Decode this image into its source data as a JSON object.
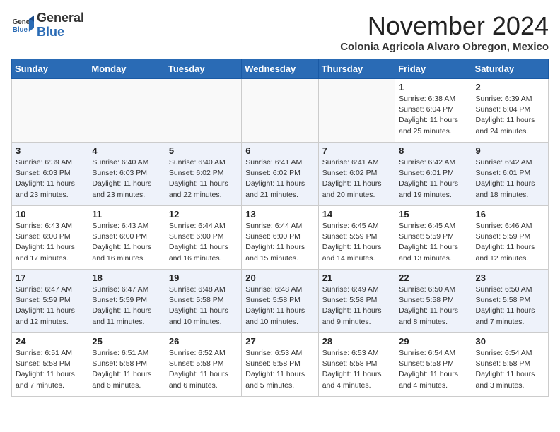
{
  "header": {
    "logo_general": "General",
    "logo_blue": "Blue",
    "month_title": "November 2024",
    "location": "Colonia Agricola Alvaro Obregon, Mexico"
  },
  "weekdays": [
    "Sunday",
    "Monday",
    "Tuesday",
    "Wednesday",
    "Thursday",
    "Friday",
    "Saturday"
  ],
  "weeks": [
    [
      {
        "day": "",
        "info": ""
      },
      {
        "day": "",
        "info": ""
      },
      {
        "day": "",
        "info": ""
      },
      {
        "day": "",
        "info": ""
      },
      {
        "day": "",
        "info": ""
      },
      {
        "day": "1",
        "info": "Sunrise: 6:38 AM\nSunset: 6:04 PM\nDaylight: 11 hours and 25 minutes."
      },
      {
        "day": "2",
        "info": "Sunrise: 6:39 AM\nSunset: 6:04 PM\nDaylight: 11 hours and 24 minutes."
      }
    ],
    [
      {
        "day": "3",
        "info": "Sunrise: 6:39 AM\nSunset: 6:03 PM\nDaylight: 11 hours and 23 minutes."
      },
      {
        "day": "4",
        "info": "Sunrise: 6:40 AM\nSunset: 6:03 PM\nDaylight: 11 hours and 23 minutes."
      },
      {
        "day": "5",
        "info": "Sunrise: 6:40 AM\nSunset: 6:02 PM\nDaylight: 11 hours and 22 minutes."
      },
      {
        "day": "6",
        "info": "Sunrise: 6:41 AM\nSunset: 6:02 PM\nDaylight: 11 hours and 21 minutes."
      },
      {
        "day": "7",
        "info": "Sunrise: 6:41 AM\nSunset: 6:02 PM\nDaylight: 11 hours and 20 minutes."
      },
      {
        "day": "8",
        "info": "Sunrise: 6:42 AM\nSunset: 6:01 PM\nDaylight: 11 hours and 19 minutes."
      },
      {
        "day": "9",
        "info": "Sunrise: 6:42 AM\nSunset: 6:01 PM\nDaylight: 11 hours and 18 minutes."
      }
    ],
    [
      {
        "day": "10",
        "info": "Sunrise: 6:43 AM\nSunset: 6:00 PM\nDaylight: 11 hours and 17 minutes."
      },
      {
        "day": "11",
        "info": "Sunrise: 6:43 AM\nSunset: 6:00 PM\nDaylight: 11 hours and 16 minutes."
      },
      {
        "day": "12",
        "info": "Sunrise: 6:44 AM\nSunset: 6:00 PM\nDaylight: 11 hours and 16 minutes."
      },
      {
        "day": "13",
        "info": "Sunrise: 6:44 AM\nSunset: 6:00 PM\nDaylight: 11 hours and 15 minutes."
      },
      {
        "day": "14",
        "info": "Sunrise: 6:45 AM\nSunset: 5:59 PM\nDaylight: 11 hours and 14 minutes."
      },
      {
        "day": "15",
        "info": "Sunrise: 6:45 AM\nSunset: 5:59 PM\nDaylight: 11 hours and 13 minutes."
      },
      {
        "day": "16",
        "info": "Sunrise: 6:46 AM\nSunset: 5:59 PM\nDaylight: 11 hours and 12 minutes."
      }
    ],
    [
      {
        "day": "17",
        "info": "Sunrise: 6:47 AM\nSunset: 5:59 PM\nDaylight: 11 hours and 12 minutes."
      },
      {
        "day": "18",
        "info": "Sunrise: 6:47 AM\nSunset: 5:59 PM\nDaylight: 11 hours and 11 minutes."
      },
      {
        "day": "19",
        "info": "Sunrise: 6:48 AM\nSunset: 5:58 PM\nDaylight: 11 hours and 10 minutes."
      },
      {
        "day": "20",
        "info": "Sunrise: 6:48 AM\nSunset: 5:58 PM\nDaylight: 11 hours and 10 minutes."
      },
      {
        "day": "21",
        "info": "Sunrise: 6:49 AM\nSunset: 5:58 PM\nDaylight: 11 hours and 9 minutes."
      },
      {
        "day": "22",
        "info": "Sunrise: 6:50 AM\nSunset: 5:58 PM\nDaylight: 11 hours and 8 minutes."
      },
      {
        "day": "23",
        "info": "Sunrise: 6:50 AM\nSunset: 5:58 PM\nDaylight: 11 hours and 7 minutes."
      }
    ],
    [
      {
        "day": "24",
        "info": "Sunrise: 6:51 AM\nSunset: 5:58 PM\nDaylight: 11 hours and 7 minutes."
      },
      {
        "day": "25",
        "info": "Sunrise: 6:51 AM\nSunset: 5:58 PM\nDaylight: 11 hours and 6 minutes."
      },
      {
        "day": "26",
        "info": "Sunrise: 6:52 AM\nSunset: 5:58 PM\nDaylight: 11 hours and 6 minutes."
      },
      {
        "day": "27",
        "info": "Sunrise: 6:53 AM\nSunset: 5:58 PM\nDaylight: 11 hours and 5 minutes."
      },
      {
        "day": "28",
        "info": "Sunrise: 6:53 AM\nSunset: 5:58 PM\nDaylight: 11 hours and 4 minutes."
      },
      {
        "day": "29",
        "info": "Sunrise: 6:54 AM\nSunset: 5:58 PM\nDaylight: 11 hours and 4 minutes."
      },
      {
        "day": "30",
        "info": "Sunrise: 6:54 AM\nSunset: 5:58 PM\nDaylight: 11 hours and 3 minutes."
      }
    ]
  ]
}
